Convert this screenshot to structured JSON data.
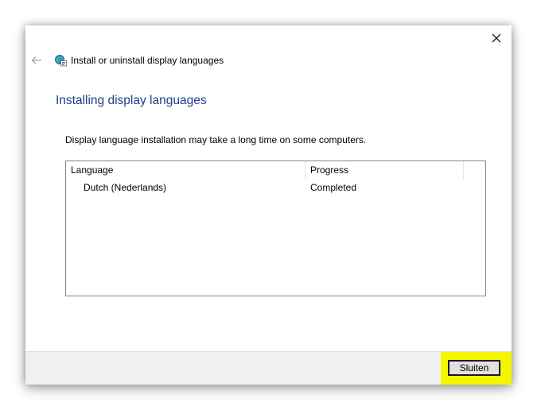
{
  "window": {
    "title": "Install or uninstall display languages",
    "close_icon": "close-icon",
    "back_icon": "arrow-left-icon",
    "title_icon": "language-globe-icon"
  },
  "main": {
    "heading": "Installing display languages",
    "description": "Display language installation may take a long time on some computers."
  },
  "table": {
    "columns": [
      "Language",
      "Progress"
    ],
    "rows": [
      {
        "language": "Dutch (Nederlands)",
        "progress": "Completed"
      }
    ]
  },
  "footer": {
    "close_button_label": "Sluiten",
    "highlight_color": "#f5f500"
  },
  "colors": {
    "heading": "#1e3f8a",
    "footer_bg": "#f0f0f0"
  }
}
